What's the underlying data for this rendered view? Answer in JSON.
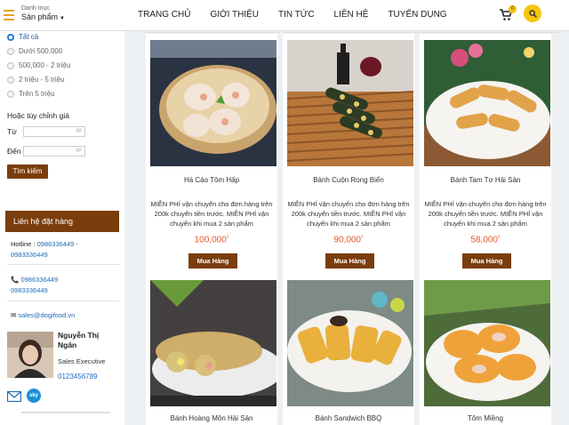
{
  "header": {
    "logo_text": "Danh mục",
    "category_label": "Sản phẩm",
    "nav": [
      "TRANG CHỦ",
      "GIỚI THIỆU",
      "TIN TỨC",
      "LIÊN HỆ",
      "TUYỂN DỤNG"
    ],
    "cart_count": "0"
  },
  "filter": {
    "options": [
      "Tất cả",
      "Dưới 500,000",
      "500,000 - 2 triệu",
      "2 triệu - 5 triệu",
      "Trên 5 triệu"
    ],
    "selected_index": 0,
    "custom_title": "Hoặc tùy chỉnh giá",
    "from_label": "Từ",
    "to_label": "Đến",
    "from_placeholder": "0₫",
    "to_placeholder": "0₫",
    "search_button": "Tìm kiếm"
  },
  "contact": {
    "title": "Liên hệ đặt hàng",
    "hotline_label": "Hotline :",
    "hotline_1": "0986336449 -",
    "hotline_2": "0983336449",
    "phone_1": "0986336449",
    "phone_2": "0983336449",
    "email": "sales@dogifood.vn",
    "rep_name": "Nguyễn Thị Ngân",
    "rep_role": "Sales Executive",
    "rep_phone": "0123456789",
    "skype_label": "sky"
  },
  "products": [
    {
      "name": "Há Cảo Tôm Hấp",
      "desc": "MIỄN PHÍ vận chuyển cho đơn hàng trên 200k chuyển tiền trước. MIỄN PHÍ vận chuyển khi mua 2 sản phẩm",
      "price": "100,000",
      "currency": "₫",
      "button": "Mua Hàng"
    },
    {
      "name": "Bánh Cuộn Rong Biển",
      "desc": "MIỄN PHÍ vận chuyển cho đơn hàng trên 200k chuyển tiền trước. MIỄN PHÍ vận chuyển khi mua 2 sản phẩm",
      "price": "90,000",
      "currency": "₫",
      "button": "Mua Hàng"
    },
    {
      "name": "Bánh Tam Tơ Hải Sản",
      "desc": "MIỄN PHÍ vận chuyển cho đơn hàng trên 200k chuyển tiền trước. MIỄN PHÍ vận chuyển khi mua 2 sản phẩm",
      "price": "58,000",
      "currency": "₫",
      "button": "Mua Hàng"
    },
    {
      "name": "Bánh Hoàng Môn Hải Sản"
    },
    {
      "name": "Bánh Sandwich BBQ"
    },
    {
      "name": "Tôm Miềng"
    }
  ],
  "colors": {
    "brand": "#7a3d0c",
    "accent": "#f7c510",
    "price": "#e4572e",
    "link": "#1e6bb8"
  }
}
